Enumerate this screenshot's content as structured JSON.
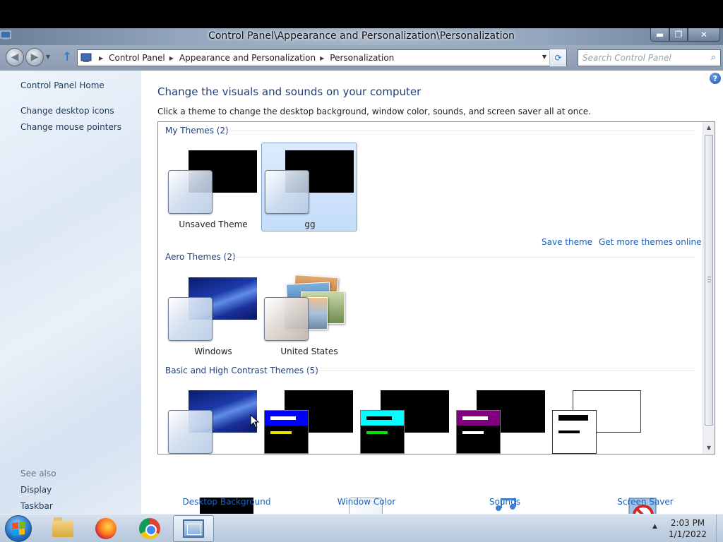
{
  "window": {
    "title": "Control Panel\\Appearance and Personalization\\Personalization",
    "minimize_glyph": "▬",
    "maximize_glyph": "❐",
    "close_glyph": "✕"
  },
  "address_bar": {
    "crumbs": [
      "Control Panel",
      "Appearance and Personalization",
      "Personalization"
    ]
  },
  "search": {
    "placeholder": "Search Control Panel"
  },
  "sidebar": {
    "home_label": "Control Panel Home",
    "links": [
      "Change desktop icons",
      "Change mouse pointers"
    ],
    "see_also_label": "See also",
    "see_also_links": [
      "Display",
      "Taskbar"
    ]
  },
  "main": {
    "title": "Change the visuals and sounds on your computer",
    "description": "Click a theme to change the desktop background, window color, sounds, and screen saver all at once.",
    "help_glyph": "?"
  },
  "themes": {
    "groups": [
      {
        "label": "My Themes (2)",
        "items": [
          "Unsaved Theme",
          "gg"
        ],
        "selected_index": 1
      },
      {
        "label": "Aero Themes (2)",
        "items": [
          "Windows",
          "United States"
        ]
      },
      {
        "label": "Basic and High Contrast Themes (5)",
        "items": []
      }
    ],
    "save_theme_label": "Save theme",
    "more_online_label": "Get more themes online"
  },
  "bottom_settings": [
    "Desktop Background",
    "Window Color",
    "Sounds",
    "Screen Saver"
  ],
  "taskbar": {
    "time": "2:03 PM",
    "date": "1/1/2022"
  },
  "colors": {
    "link": "#1e5fb7",
    "heading": "#1e3e7a",
    "hc_bar_blue": "#0000ff",
    "hc_bar_cyan": "#00ffff",
    "hc_bar_purple": "#800080",
    "hc_line_yellow": "#e5e500",
    "hc_line_green": "#00e500"
  }
}
